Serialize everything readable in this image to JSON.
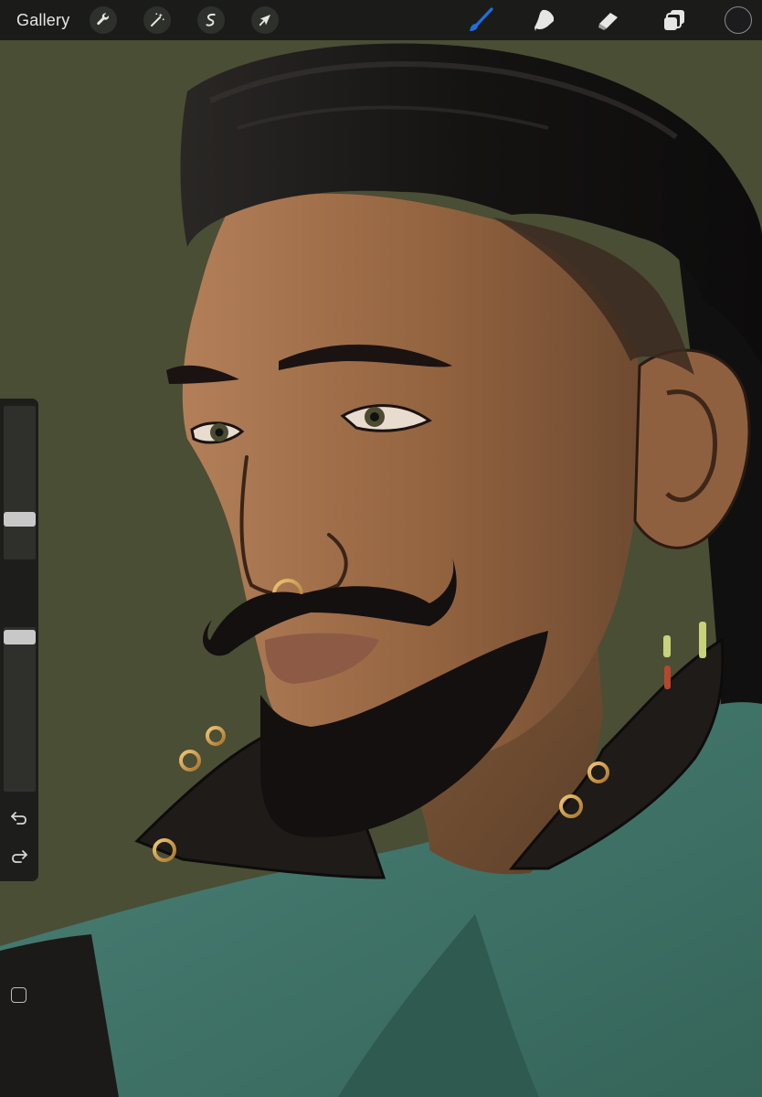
{
  "toolbar": {
    "gallery_label": "Gallery",
    "left_tools": [
      {
        "name": "actions",
        "icon": "wrench-icon"
      },
      {
        "name": "adjustments",
        "icon": "magic-wand-icon"
      },
      {
        "name": "selection",
        "icon": "selection-s-icon"
      },
      {
        "name": "transform",
        "icon": "arrow-cursor-icon"
      }
    ],
    "right_tools": [
      {
        "name": "brush",
        "icon": "brush-icon",
        "active": true
      },
      {
        "name": "smudge",
        "icon": "smudge-finger-icon",
        "active": false
      },
      {
        "name": "eraser",
        "icon": "eraser-icon",
        "active": false
      },
      {
        "name": "layers",
        "icon": "layers-icon",
        "active": false
      }
    ],
    "current_color": "#1c1c1e",
    "accent_color": "#1f6fe0"
  },
  "sidebar": {
    "brush_size_level": 0.24,
    "opacity_level": 0.98,
    "modify_button_icon": "square-outline-icon",
    "undo_icon": "undo-arrow-icon",
    "redo_icon": "redo-arrow-icon"
  }
}
